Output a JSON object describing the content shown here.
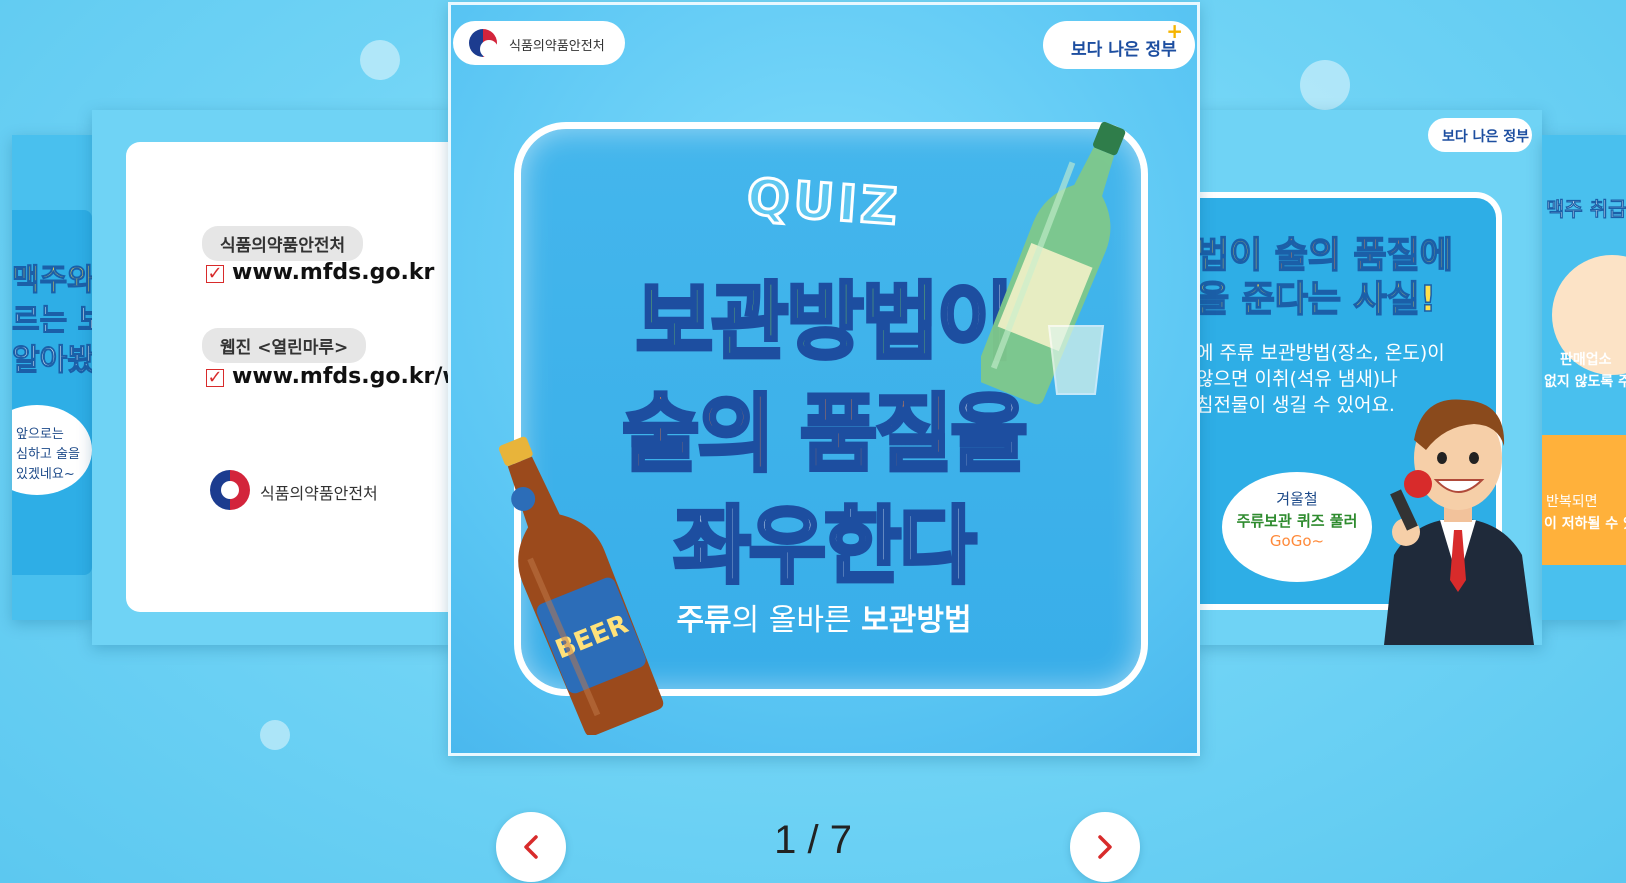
{
  "org": {
    "name": "식품의약품안전처",
    "slogan": "보다 나은 정부"
  },
  "left_card": {
    "pill1": "식품의약품안전처",
    "url1": "www.mfds.go.kr",
    "pill2": "웹진 <열린마루>",
    "url2": "www.mfds.go.kr/we"
  },
  "far_left_card": {
    "line1": "맥주와",
    "line2": "르는 보",
    "line3": "알아봤",
    "bubble1": "앞으로는",
    "bubble2": "심하고 술을",
    "bubble3": "있겠네요~"
  },
  "slide": {
    "quiz": "QUIZ",
    "headline_l1_green": "보관방법",
    "headline_l1_white": "이",
    "headline_l2_orange": "술의 품질",
    "headline_l2_white": "을",
    "headline_l3": "좌우한다",
    "sub_bold1": "주류",
    "sub_mid": "의 올바른 ",
    "sub_bold2": "보관방법",
    "beer_label": "BEER"
  },
  "right_card": {
    "title1_pre": "법이 ",
    "title1_orange": "술의 품질",
    "title1_post": "에",
    "title2": "을 준다는 사실!",
    "body1": "에 주류 보관방법(장소, 온도)이",
    "body2": "않으면 이취(석유 냄새)나",
    "body3": "침전물이 생길 수 있어요.",
    "bubble1": "겨울철",
    "bubble2": "주류보관 퀴즈 풀러",
    "bubble3": "GoGo~"
  },
  "far_right_card": {
    "top": "맥주 취급",
    "mid1": "판매업소",
    "mid2": "없지 않도록 주",
    "bot1": "반복되면",
    "bot2": "이 저하될 수 있"
  },
  "pager": {
    "current": "1",
    "separator": "/",
    "total": "7"
  },
  "colors": {
    "accent_red": "#d82b2b",
    "navy": "#1d4ea0",
    "green": "#8bea4a",
    "orange": "#ff8a3a"
  }
}
